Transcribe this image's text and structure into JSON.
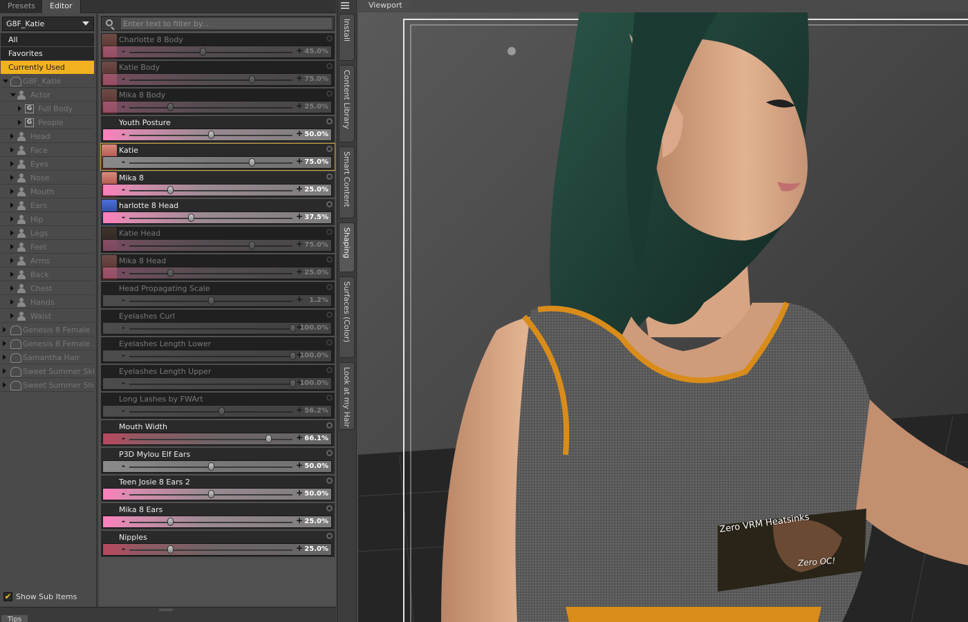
{
  "tabs": [
    {
      "label": "Presets",
      "active": false
    },
    {
      "label": "Editor",
      "active": true
    }
  ],
  "figure_select": "G8F_Katie",
  "filter_placeholder": "Enter text to filter by...",
  "tree": [
    {
      "label": "All",
      "type": "plain",
      "style": "dark"
    },
    {
      "label": "Favorites",
      "type": "plain",
      "style": "dark"
    },
    {
      "label": "Currently Used",
      "type": "plain",
      "style": "selected"
    },
    {
      "label": "G8F_Katie",
      "type": "group",
      "indent": 0,
      "expanded": true
    },
    {
      "label": "Actor",
      "type": "person",
      "indent": 1,
      "expanded": true
    },
    {
      "label": "Full Body",
      "type": "g",
      "indent": 2,
      "expanded": false
    },
    {
      "label": "People",
      "type": "g",
      "indent": 2,
      "expanded": false
    },
    {
      "label": "Head",
      "type": "person",
      "indent": 1,
      "expanded": false
    },
    {
      "label": "Face",
      "type": "person",
      "indent": 1,
      "expanded": false
    },
    {
      "label": "Eyes",
      "type": "person",
      "indent": 1,
      "expanded": false
    },
    {
      "label": "Nose",
      "type": "person",
      "indent": 1,
      "expanded": false
    },
    {
      "label": "Mouth",
      "type": "person",
      "indent": 1,
      "expanded": false
    },
    {
      "label": "Ears",
      "type": "person",
      "indent": 1,
      "expanded": false
    },
    {
      "label": "Hip",
      "type": "person",
      "indent": 1,
      "expanded": false
    },
    {
      "label": "Legs",
      "type": "person",
      "indent": 1,
      "expanded": false
    },
    {
      "label": "Feet",
      "type": "person",
      "indent": 1,
      "expanded": false
    },
    {
      "label": "Arms",
      "type": "person",
      "indent": 1,
      "expanded": false
    },
    {
      "label": "Back",
      "type": "person",
      "indent": 1,
      "expanded": false
    },
    {
      "label": "Chest",
      "type": "person",
      "indent": 1,
      "expanded": false
    },
    {
      "label": "Hands",
      "type": "person",
      "indent": 1,
      "expanded": false
    },
    {
      "label": "Waist",
      "type": "person",
      "indent": 1,
      "expanded": false
    },
    {
      "label": "Genesis 8 Female ...",
      "type": "group",
      "indent": 0,
      "expanded": false
    },
    {
      "label": "Genesis 8 Female ...",
      "type": "group",
      "indent": 0,
      "expanded": false
    },
    {
      "label": "Samantha Hair",
      "type": "group",
      "indent": 0,
      "expanded": false
    },
    {
      "label": "Sweet Summer Skirt",
      "type": "group",
      "indent": 0,
      "expanded": false
    },
    {
      "label": "Sweet Summer Shirt",
      "type": "group",
      "indent": 0,
      "expanded": false
    }
  ],
  "show_sub_items": {
    "label": "Show Sub Items",
    "checked": true
  },
  "sliders": [
    {
      "name": "Charlotte 8 Body",
      "value": "45.0%",
      "pos": 0.45,
      "dim": true,
      "thumb": "red",
      "track": "pink"
    },
    {
      "name": "Katie Body",
      "value": "75.0%",
      "pos": 0.75,
      "dim": true,
      "thumb": "red",
      "track": "pink"
    },
    {
      "name": "Mika 8 Body",
      "value": "25.0%",
      "pos": 0.25,
      "dim": true,
      "thumb": "red",
      "track": "pink"
    },
    {
      "name": "Youth Posture",
      "value": "50.0%",
      "pos": 0.5,
      "dim": false,
      "thumb": "",
      "track": "pink"
    },
    {
      "name": "Katie",
      "value": "75.0%",
      "pos": 0.75,
      "dim": false,
      "thumb": "red",
      "track": "grey",
      "highlight": true
    },
    {
      "name": "Mika 8",
      "value": "25.0%",
      "pos": 0.25,
      "dim": false,
      "thumb": "red",
      "track": "pink"
    },
    {
      "name": "harlotte 8 Head",
      "value": "37.5%",
      "pos": 0.375,
      "dim": false,
      "thumb": "blue",
      "track": "pink"
    },
    {
      "name": "Katie Head",
      "value": "75.0%",
      "pos": 0.75,
      "dim": true,
      "thumb": "dark",
      "track": "pink"
    },
    {
      "name": "Mika 8 Head",
      "value": "25.0%",
      "pos": 0.25,
      "dim": true,
      "thumb": "red",
      "track": "pink"
    },
    {
      "name": "Head Propagating Scale",
      "value": "1.2%",
      "pos": 0.5,
      "dim": true,
      "thumb": "",
      "track": "grey"
    },
    {
      "name": "Eyelashes Curl",
      "value": "100.0%",
      "pos": 1.0,
      "dim": true,
      "thumb": "",
      "track": "grey"
    },
    {
      "name": "Eyelashes Length Lower",
      "value": "100.0%",
      "pos": 1.0,
      "dim": true,
      "thumb": "",
      "track": "grey"
    },
    {
      "name": "Eyelashes Length Upper",
      "value": "100.0%",
      "pos": 1.0,
      "dim": true,
      "thumb": "",
      "track": "grey"
    },
    {
      "name": "Long Lashes by FWArt",
      "value": "56.2%",
      "pos": 0.562,
      "dim": true,
      "thumb": "",
      "track": "grey"
    },
    {
      "name": "Mouth Width",
      "value": "66.1%",
      "pos": 0.85,
      "dim": false,
      "thumb": "",
      "track": "dark"
    },
    {
      "name": "P3D Mylou Elf Ears",
      "value": "50.0%",
      "pos": 0.5,
      "dim": false,
      "thumb": "",
      "track": "grey"
    },
    {
      "name": "Teen Josie 8 Ears 2",
      "value": "50.0%",
      "pos": 0.5,
      "dim": false,
      "thumb": "",
      "track": "pink"
    },
    {
      "name": "Mika 8 Ears",
      "value": "25.0%",
      "pos": 0.25,
      "dim": false,
      "thumb": "",
      "track": "pink"
    },
    {
      "name": "Nipples",
      "value": "25.0%",
      "pos": 0.25,
      "dim": false,
      "thumb": "",
      "track": "dark"
    }
  ],
  "side_tabs": [
    {
      "label": "Install",
      "active": false
    },
    {
      "label": "Content Library",
      "active": false
    },
    {
      "label": "Smart Content",
      "active": false
    },
    {
      "label": "Shaping",
      "active": true
    },
    {
      "label": "Surfaces (Color)",
      "active": false
    },
    {
      "label": "Look at my Hair",
      "active": false
    }
  ],
  "viewport": {
    "tab_label": "Viewport",
    "shirt_text_1": "Zero VRM Heatsinks",
    "shirt_text_2": "Zero OC!"
  },
  "bottom_tab": "Tips",
  "colors": {
    "accent": "#f2b21f",
    "panel": "#4a4a4a",
    "hair": "#1d3b34",
    "shirt": "#5a5a5a",
    "trim": "#d98c1a"
  }
}
